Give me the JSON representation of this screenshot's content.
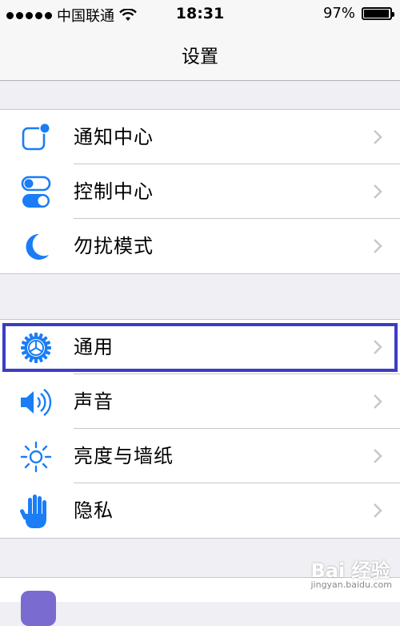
{
  "status_bar": {
    "carrier": "中国联通",
    "time": "18:31",
    "battery_percent_text": "97%",
    "battery_level": 0.97
  },
  "nav": {
    "title": "设置"
  },
  "groups": [
    {
      "items": [
        {
          "label": "通知中心",
          "icon": "notification-center-icon"
        },
        {
          "label": "控制中心",
          "icon": "control-center-toggle-icon"
        },
        {
          "label": "勿扰模式",
          "icon": "moon-icon"
        }
      ]
    },
    {
      "items": [
        {
          "label": "通用",
          "icon": "gear-icon",
          "highlighted": true
        },
        {
          "label": "声音",
          "icon": "speaker-icon"
        },
        {
          "label": "亮度与墙纸",
          "icon": "sun-icon"
        },
        {
          "label": "隐私",
          "icon": "hand-icon"
        }
      ]
    }
  ],
  "colors": {
    "accent": "#1a7df5",
    "highlight_border": "#3b3dc4",
    "chevron": "#c7c7cc",
    "group_bg": "#efeff4"
  },
  "watermark": {
    "brand": "Bai 经验",
    "url": "jingyan.baidu.com"
  }
}
